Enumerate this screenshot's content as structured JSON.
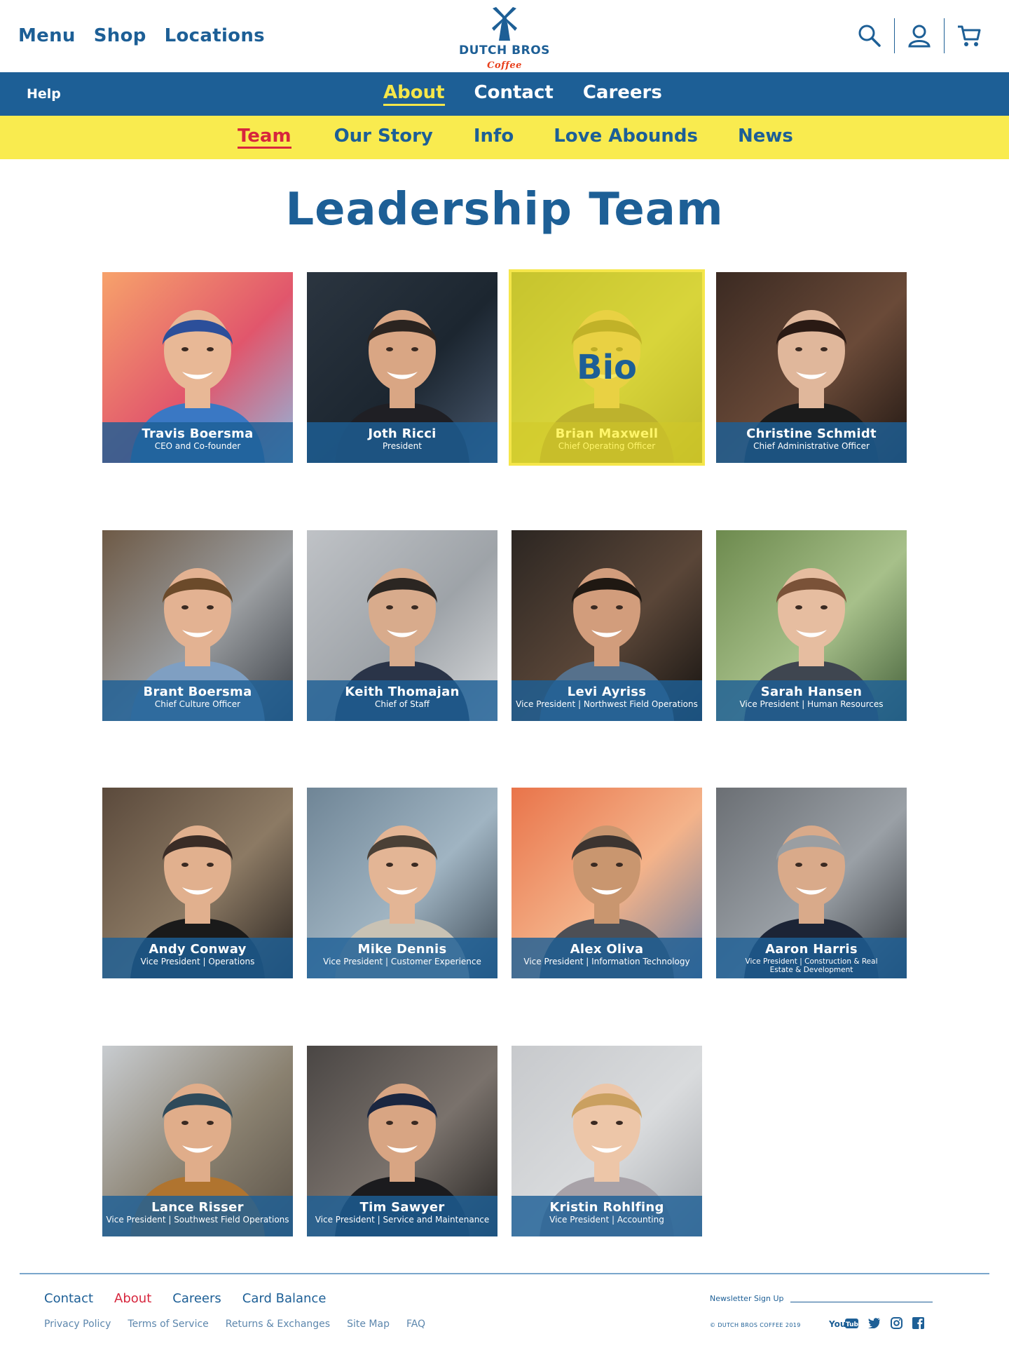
{
  "header": {
    "nav": [
      "Menu",
      "Shop",
      "Locations"
    ],
    "logo": {
      "brand": "DUTCH BROS",
      "sub": "Coffee"
    },
    "icons": [
      "search-icon",
      "account-icon",
      "cart-icon"
    ]
  },
  "subnav": {
    "help": "Help",
    "items": [
      "About",
      "Contact",
      "Careers"
    ],
    "active": "About"
  },
  "tertiary_nav": {
    "items": [
      "Team",
      "Our Story",
      "Info",
      "Love Abounds",
      "News"
    ],
    "active": "Team"
  },
  "page": {
    "title": "Leadership Team"
  },
  "hover_label": "Bio",
  "team": [
    {
      "name": "Travis Boersma",
      "title": "CEO and Co-founder"
    },
    {
      "name": "Joth Ricci",
      "title": "President"
    },
    {
      "name": "Brian Maxwell",
      "title": "Chief Operating Officer"
    },
    {
      "name": "Christine Schmidt",
      "title": "Chief Administrative Officer"
    },
    {
      "name": "Brant Boersma",
      "title": "Chief Culture Officer"
    },
    {
      "name": "Keith Thomajan",
      "title": "Chief of Staff"
    },
    {
      "name": "Levi Ayriss",
      "title": "Vice President | Northwest Field Operations"
    },
    {
      "name": "Sarah Hansen",
      "title": "Vice President | Human Resources"
    },
    {
      "name": "Andy Conway",
      "title": "Vice President | Operations"
    },
    {
      "name": "Mike Dennis",
      "title": "Vice President | Customer Experience"
    },
    {
      "name": "Alex Oliva",
      "title": "Vice President | Information Technology"
    },
    {
      "name": "Aaron Harris",
      "title": "Vice President | Construction & Real Estate & Development"
    },
    {
      "name": "Lance Risser",
      "title": "Vice President | Southwest Field Operations"
    },
    {
      "name": "Tim Sawyer",
      "title": "Vice President | Service and Maintenance"
    },
    {
      "name": "Kristin Rohlfing",
      "title": "Vice President | Accounting"
    }
  ],
  "footer": {
    "links": [
      "Contact",
      "About",
      "Careers",
      "Card Balance"
    ],
    "active": "About",
    "sub_links": [
      "Privacy Policy",
      "Terms of Service",
      "Returns & Exchanges",
      "Site Map",
      "FAQ"
    ],
    "newsletter_label": "Newsletter Sign Up",
    "copyright": "© DUTCH BROS COFFEE 2019",
    "social_icons": [
      "youtube-icon",
      "twitter-icon",
      "instagram-icon",
      "facebook-icon"
    ]
  },
  "colors": {
    "brand_blue": "#1d5f96",
    "brand_yellow": "#f9eb4f",
    "active_red": "#d7263d"
  }
}
